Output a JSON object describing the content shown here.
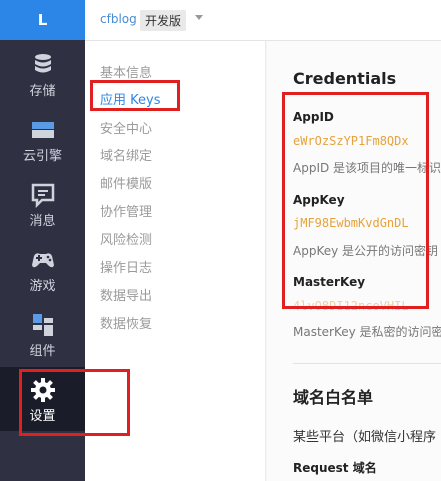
{
  "sidebar": {
    "logo": "L",
    "items": [
      {
        "label": "存储",
        "icon": "database-icon"
      },
      {
        "label": "云引擎",
        "icon": "server-icon"
      },
      {
        "label": "消息",
        "icon": "message-icon"
      },
      {
        "label": "游戏",
        "icon": "gamepad-icon"
      },
      {
        "label": "组件",
        "icon": "components-icon"
      },
      {
        "label": "设置",
        "icon": "gear-icon",
        "active": true
      }
    ]
  },
  "topbar": {
    "app_name": "cfblog",
    "environment": "开发版"
  },
  "settings_menu": {
    "items": [
      {
        "label": "基本信息"
      },
      {
        "label": "应用 Keys",
        "active": true
      },
      {
        "label": "安全中心"
      },
      {
        "label": "域名绑定"
      },
      {
        "label": "邮件模版"
      },
      {
        "label": "协作管理"
      },
      {
        "label": "风险检测"
      },
      {
        "label": "操作日志"
      },
      {
        "label": "数据导出"
      },
      {
        "label": "数据恢复"
      }
    ]
  },
  "credentials": {
    "title": "Credentials",
    "app_id": {
      "label": "AppID",
      "value": "eWrOzSzYP1Fm8QDx",
      "hint": "AppID 是该项目的唯一标识"
    },
    "app_key": {
      "label": "AppKey",
      "value": "jMF98EwbmKvdGnDL",
      "hint": "AppKey 是公开的访问密钥"
    },
    "master_key": {
      "label": "MasterKey",
      "value": "4lvO8DI12ncoVHIL",
      "hint": "MasterKey 是私密的访问密钥"
    }
  },
  "domain_whitelist": {
    "title": "域名白名单",
    "description": "某些平台（如微信小程序",
    "request_domain_label": "Request 域名"
  },
  "colors": {
    "sidebar_bg": "#2f3143",
    "logo_bg": "#2c86e8",
    "active_link": "#2c86e8",
    "key_value": "#e6a23c",
    "annotation": "#e02020"
  }
}
